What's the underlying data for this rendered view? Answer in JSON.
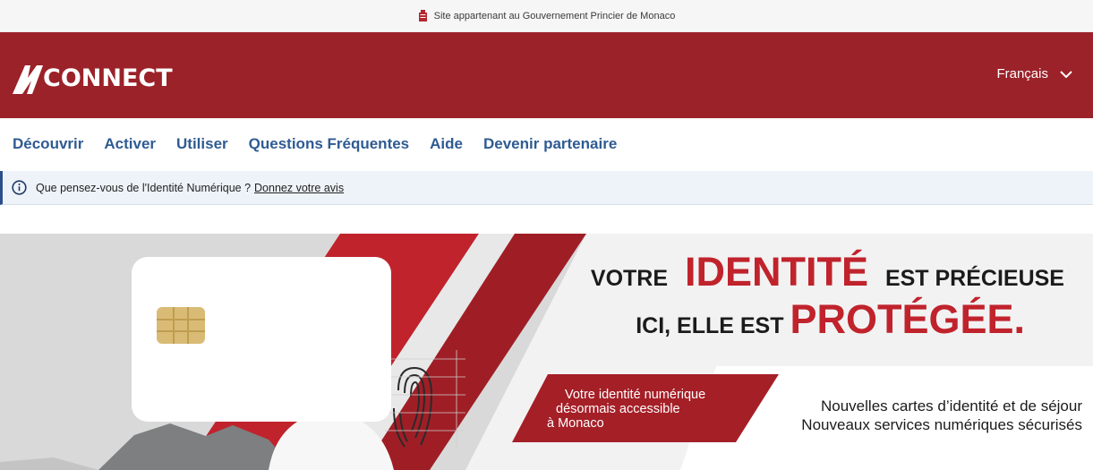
{
  "gov_bar": {
    "text": "Site appartenant au Gouvernement Princier de Monaco"
  },
  "header": {
    "logo_text": "CONNECT",
    "language": "Français"
  },
  "nav": {
    "items": [
      "Découvrir",
      "Activer",
      "Utiliser",
      "Questions Fréquentes",
      "Aide",
      "Devenir partenaire"
    ]
  },
  "notice": {
    "text": "Que pensez-vous de l'Identité Numérique ?",
    "link": "Donnez votre avis"
  },
  "banner": {
    "headline_line1_pre": "VOTRE",
    "headline_line1_big": "IDENTITÉ",
    "headline_line1_post": "EST PRÉCIEUSE",
    "headline_line2_pre": "ICI, ELLE EST",
    "headline_line2_big": "PROTÉGÉE.",
    "red_tag": [
      "Votre identité numérique",
      "désormais accessible",
      "à Monaco"
    ],
    "right_tag": [
      "Nouvelles cartes d’identité et de séjour",
      "Nouveaux services numériques sécurisés"
    ]
  },
  "colors": {
    "brand_red": "#9b2229",
    "accent_red": "#c0232c",
    "nav_blue": "#2f5b92",
    "notice_bg": "#eef3f9"
  },
  "icons": [
    "monaco-crest-icon",
    "m-logo-icon",
    "chevron-down-icon",
    "info-icon",
    "chip-icon",
    "fingerprint-icon"
  ]
}
